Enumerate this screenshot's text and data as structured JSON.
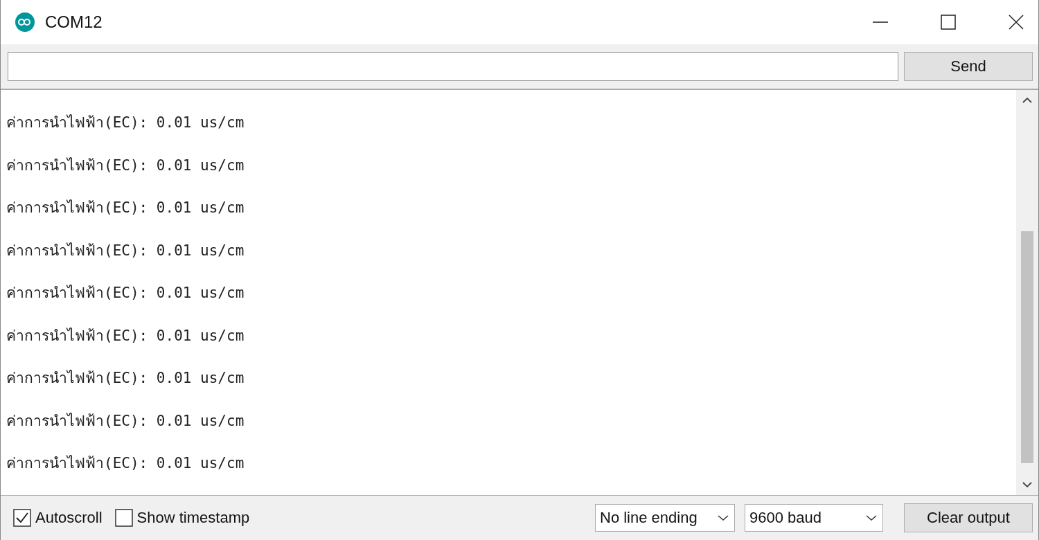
{
  "window": {
    "title": "COM12"
  },
  "send_bar": {
    "button": "Send"
  },
  "output": {
    "lines": [
      "ค่าการนำไฟฟ้า(EC): 0.01 us/cm",
      "ค่าการนำไฟฟ้า(EC): 0.01 us/cm",
      "ค่าการนำไฟฟ้า(EC): 0.01 us/cm",
      "ค่าการนำไฟฟ้า(EC): 0.01 us/cm",
      "ค่าการนำไฟฟ้า(EC): 0.01 us/cm",
      "ค่าการนำไฟฟ้า(EC): 0.01 us/cm",
      "ค่าการนำไฟฟ้า(EC): 0.01 us/cm",
      "ค่าการนำไฟฟ้า(EC): 0.01 us/cm",
      "ค่าการนำไฟฟ้า(EC): 0.01 us/cm"
    ]
  },
  "status_bar": {
    "checkboxes": [
      {
        "label": "Autoscroll",
        "checked": true
      },
      {
        "label": "Show timestamp",
        "checked": false
      }
    ],
    "dropdowns": [
      {
        "value": "No line ending"
      },
      {
        "value": "9600 baud"
      }
    ],
    "button": "Clear output"
  }
}
